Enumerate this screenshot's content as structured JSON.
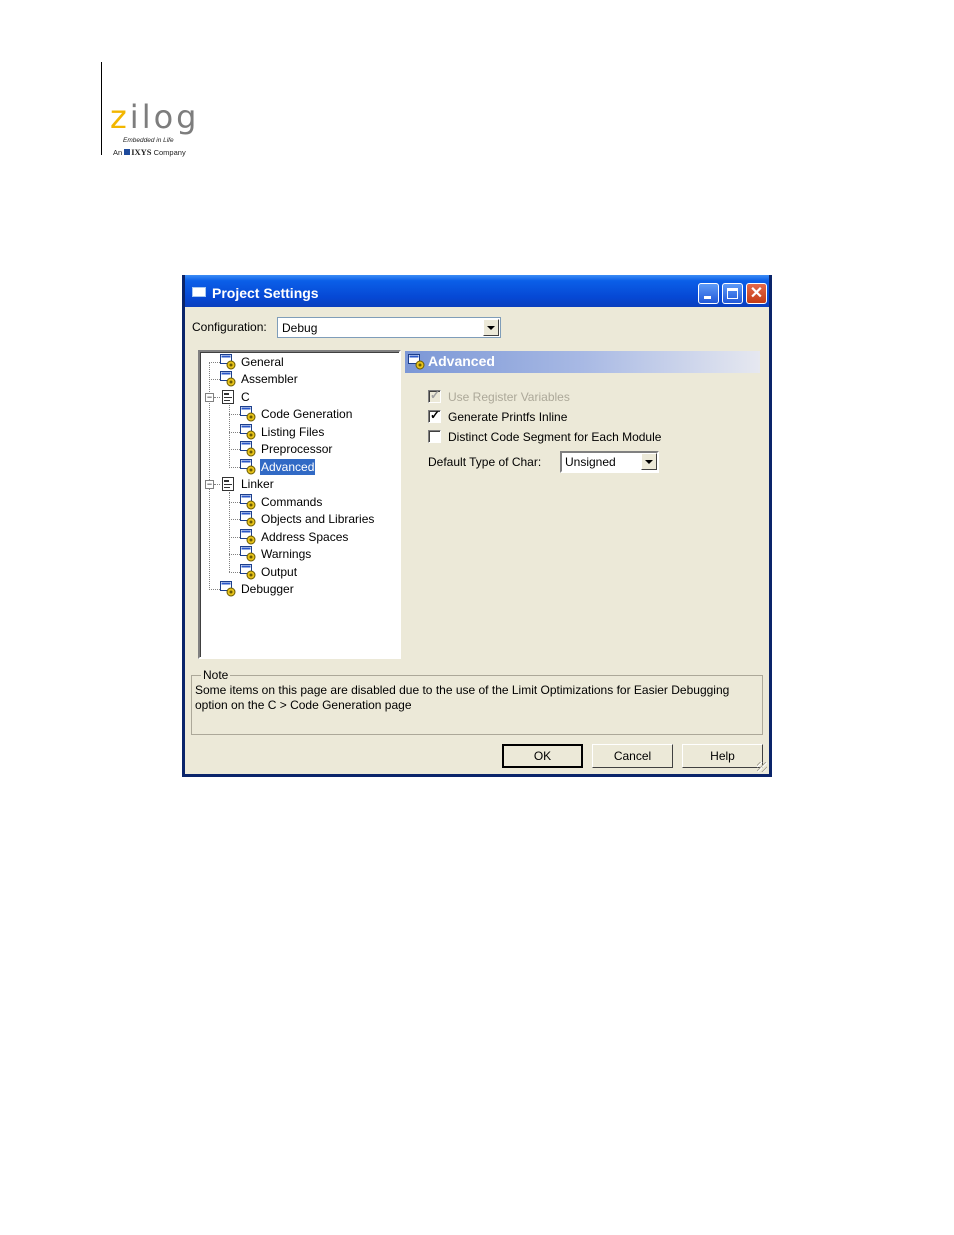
{
  "brand": {
    "logo_text": "zilog",
    "tagline": "Embedded in Life",
    "company_prefix": "An",
    "company_name": "IXYS",
    "company_suffix": "Company"
  },
  "window": {
    "title": "Project Settings",
    "config_label": "Configuration:",
    "config_value": "Debug"
  },
  "tree": {
    "items": [
      {
        "label": "General"
      },
      {
        "label": "Assembler"
      },
      {
        "label": "C"
      },
      {
        "label": "Code Generation"
      },
      {
        "label": "Listing Files"
      },
      {
        "label": "Preprocessor"
      },
      {
        "label": "Advanced",
        "selected": true
      },
      {
        "label": "Linker"
      },
      {
        "label": "Commands"
      },
      {
        "label": "Objects and Libraries"
      },
      {
        "label": "Address Spaces"
      },
      {
        "label": "Warnings"
      },
      {
        "label": "Output"
      },
      {
        "label": "Debugger"
      }
    ]
  },
  "panel": {
    "title": "Advanced",
    "options": [
      {
        "label": "Use Register Variables",
        "checked": true,
        "disabled": true
      },
      {
        "label": "Generate Printfs Inline",
        "checked": true,
        "disabled": false
      },
      {
        "label": "Distinct Code Segment for Each Module",
        "checked": false,
        "disabled": false
      }
    ],
    "char_label": "Default Type of Char:",
    "char_value": "Unsigned"
  },
  "note": {
    "legend": "Note",
    "text": "Some items on this page are disabled due to the use of the Limit Optimizations for Easier Debugging option on the C > Code Generation page"
  },
  "buttons": {
    "ok": "OK",
    "cancel": "Cancel",
    "help": "Help"
  },
  "colors": {
    "title_bar": "#0648d4",
    "selection": "#316ac5",
    "dialog_face": "#ece9d8",
    "logo_accent": "#f2b600"
  }
}
